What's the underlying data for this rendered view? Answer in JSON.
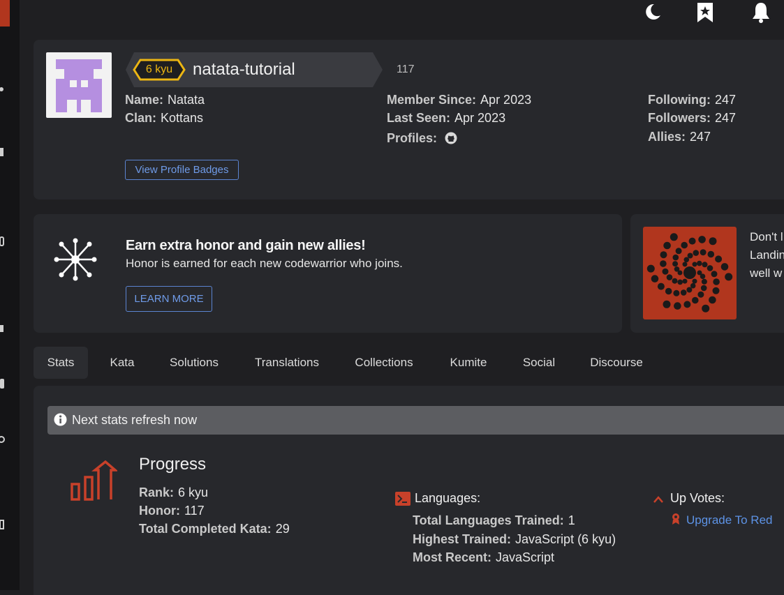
{
  "header": {
    "icons": [
      "moon-icon",
      "bookmark-star-icon",
      "bell-icon"
    ]
  },
  "profile": {
    "rank": "6 kyu",
    "username": "natata-tutorial",
    "honor": "117",
    "info_col1": [
      {
        "label": "Name:",
        "value": "Natata"
      },
      {
        "label": "Clan:",
        "value": "Kottans"
      }
    ],
    "info_col2": [
      {
        "label": "Member Since:",
        "value": "Apr 2023"
      },
      {
        "label": "Last Seen:",
        "value": "Apr 2023"
      },
      {
        "label": "Profiles:",
        "value": ""
      }
    ],
    "info_col3": [
      {
        "label": "Following:",
        "value": "247"
      },
      {
        "label": "Followers:",
        "value": "247"
      },
      {
        "label": "Allies:",
        "value": "247"
      }
    ],
    "badges_button": "View Profile Badges",
    "colors": {
      "rank_yellow": "#ecb613",
      "avatar_purple": "#b58fe0"
    }
  },
  "promo": {
    "title": "Earn extra honor and gain new allies!",
    "subtitle": "Honor is earned for each new codewarrior who joins.",
    "button": "LEARN MORE",
    "side_text": [
      "Don't l",
      "Landin",
      "well w"
    ],
    "colors": {
      "logo_bg": "#b1361e"
    }
  },
  "tabs": [
    {
      "label": "Stats",
      "active": true
    },
    {
      "label": "Kata"
    },
    {
      "label": "Solutions"
    },
    {
      "label": "Translations"
    },
    {
      "label": "Collections"
    },
    {
      "label": "Kumite"
    },
    {
      "label": "Social"
    },
    {
      "label": "Discourse"
    }
  ],
  "stats": {
    "refresh_notice": "Next stats refresh now",
    "progress": {
      "title": "Progress",
      "items": [
        {
          "label": "Rank:",
          "value": "6 kyu"
        },
        {
          "label": "Honor:",
          "value": "117"
        },
        {
          "label": "Total Completed Kata:",
          "value": "29"
        }
      ]
    },
    "languages": {
      "title": "Languages:",
      "items": [
        {
          "label": "Total Languages Trained:",
          "value": "1"
        },
        {
          "label": "Highest Trained:",
          "value": "JavaScript (6 kyu)"
        },
        {
          "label": "Most Recent:",
          "value": "JavaScript"
        }
      ]
    },
    "upvotes": {
      "title": "Up Votes:",
      "link": "Upgrade To Red"
    },
    "colors": {
      "accent_red": "#c8412a",
      "link_blue": "#5d93e6"
    }
  }
}
